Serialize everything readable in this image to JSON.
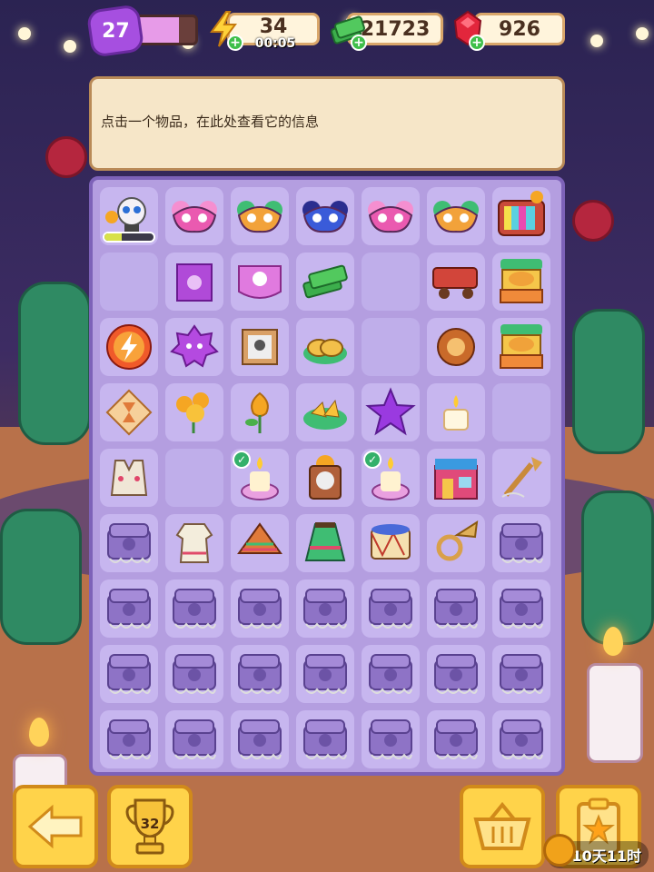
{
  "hud": {
    "level": "27",
    "xp_progress": 0.75,
    "energy": {
      "value": "34",
      "timer": "00:05",
      "icon": "lightning-icon"
    },
    "cash": {
      "value": "21723",
      "icon": "cash-stack-icon"
    },
    "gems": {
      "value": "926",
      "icon": "ruby-icon"
    }
  },
  "info_panel": {
    "message": "点击一个物品，在此处查看它的信息"
  },
  "board": {
    "rows": [
      [
        "skull-mask-with-marigold",
        "pink-flower-mask",
        "marigold-mask",
        "blue-flower-mask",
        "pink-flower-mask",
        "marigold-mask",
        "retro-tv"
      ],
      [
        "empty",
        "papel-picado-purple",
        "papel-picado-pink",
        "cash-stack",
        "empty",
        "red-cart",
        "taco-food-stall"
      ],
      [
        "energy-orb",
        "purple-star-blob",
        "framed-photo",
        "empanada-plate",
        "empty",
        "pan-de-muerto",
        "taco-food-stall"
      ],
      [
        "hourglass-tile",
        "marigold-bunch",
        "marigold-bud",
        "nachos-plate",
        "purple-star",
        "candle-small",
        "empty"
      ],
      [
        "embroidered-vest",
        "empty",
        "altar-candle",
        "skull-altar",
        "altar-candle",
        "festive-shop",
        "trumpet-web"
      ],
      [
        "locked-skull-box",
        "embroidered-dress",
        "poncho",
        "folk-skirt",
        "drum",
        "tuba",
        "locked-skull-box"
      ],
      [
        "locked-skull-box",
        "locked-skull-box",
        "locked-skull-box",
        "locked-skull-box",
        "locked-skull-box",
        "locked-skull-box",
        "locked-skull-box"
      ],
      [
        "locked-skull-box",
        "locked-skull-box",
        "locked-skull-box",
        "locked-skull-box",
        "locked-skull-box",
        "locked-skull-box",
        "locked-skull-box"
      ],
      [
        "locked-skull-box",
        "locked-skull-box",
        "locked-skull-box",
        "locked-skull-box",
        "locked-skull-box",
        "locked-skull-box",
        "locked-skull-box"
      ]
    ],
    "generator_progress": 0.35
  },
  "bottom_bar": {
    "back_icon": "arrow-left-icon",
    "trophy_icon": "trophy-icon",
    "trophy_count": "32",
    "basket_icon": "basket-icon",
    "event_icon": "clipboard-star-icon",
    "event_timer": "10天11时"
  },
  "colors": {
    "board_bg": "#b49ee0",
    "cell_bg": "#c7b6ef",
    "button": "#ffd34a",
    "info_bg": "#f6e6c8"
  }
}
